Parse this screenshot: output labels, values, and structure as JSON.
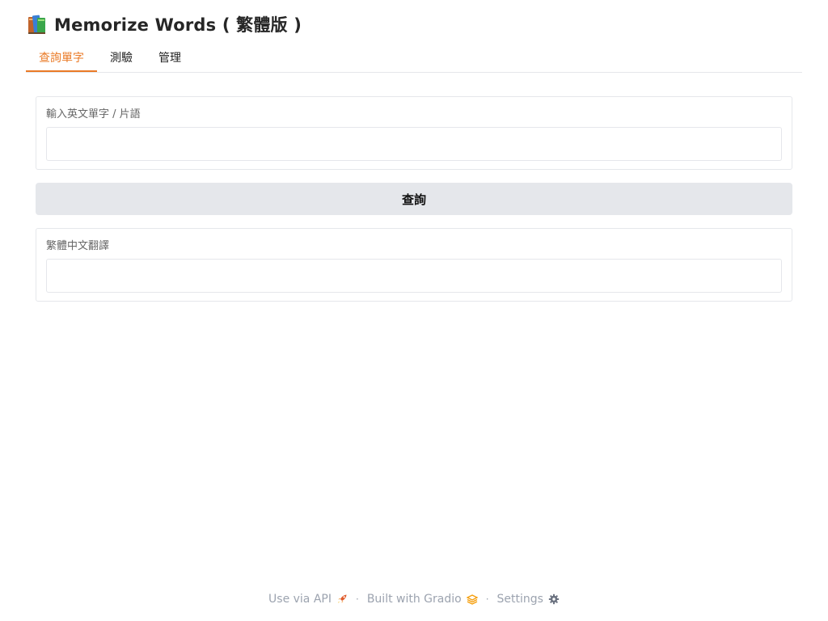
{
  "header": {
    "icon": "books-icon",
    "title": "Memorize Words ( 繁體版 )"
  },
  "tabs": [
    {
      "label": "查詢單字",
      "active": true
    },
    {
      "label": "測驗",
      "active": false
    },
    {
      "label": "管理",
      "active": false
    }
  ],
  "query_panel": {
    "input_label": "輸入英文單字 / 片語",
    "input_value": "",
    "input_placeholder": "",
    "button_label": "查詢",
    "output_label": "繁體中文翻譯",
    "output_value": ""
  },
  "footer": {
    "api_label": "Use via API",
    "api_icon": "rocket-icon",
    "built_label": "Built with Gradio",
    "built_icon": "gradio-logo-icon",
    "settings_label": "Settings",
    "settings_icon": "gear-icon",
    "separator": "·"
  },
  "colors": {
    "accent": "#ea7a26",
    "button_bg": "#e5e7eb",
    "border": "#e5e7eb",
    "muted_text": "#9ca3af"
  }
}
